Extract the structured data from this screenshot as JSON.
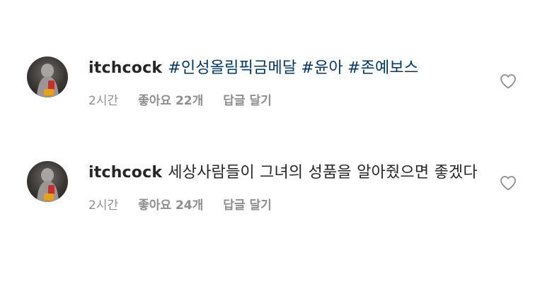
{
  "comments": [
    {
      "username": "itchcock",
      "hashtags": [
        "#인성올림픽금메달",
        "#윤아",
        "#존예보스"
      ],
      "text": "",
      "time": "2시간",
      "likes": "좋아요 22개",
      "reply_label": "답글 달기",
      "icon": "heart-outline-icon"
    },
    {
      "username": "itchcock",
      "hashtags": [],
      "text": "세상사람들이 그녀의 성품을 알아줬으면 좋겠다",
      "time": "2시간",
      "likes": "좋아요 24개",
      "reply_label": "답글 달기",
      "icon": "heart-outline-icon"
    }
  ],
  "colors": {
    "text": "#262626",
    "hashtag": "#00376b",
    "meta": "#8e8e8e"
  }
}
